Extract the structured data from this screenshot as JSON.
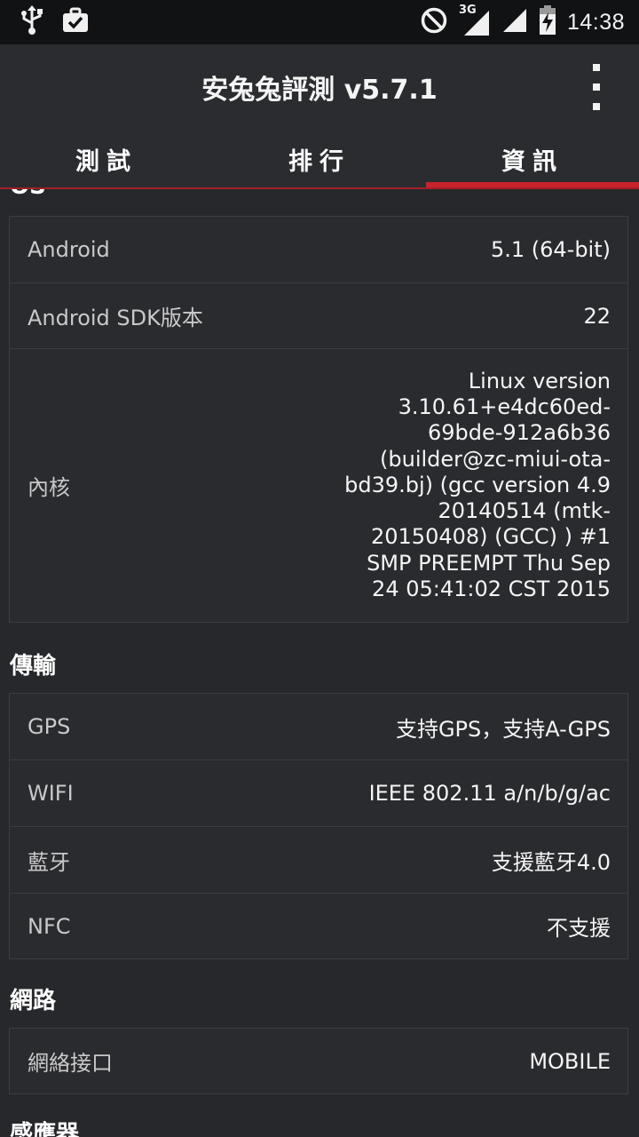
{
  "status_bar": {
    "time": "14:38",
    "network_type": "3G",
    "icons": [
      "usb-icon",
      "briefcase-check-icon",
      "do-not-disturb-icon",
      "signal-3g-icon",
      "signal-icon",
      "battery-charging-icon"
    ]
  },
  "app_bar": {
    "title": "安兔兔評測 v5.7.1"
  },
  "tabs": [
    {
      "label": "測試",
      "active": false
    },
    {
      "label": "排行",
      "active": false
    },
    {
      "label": "資訊",
      "active": true
    }
  ],
  "sections": {
    "os": {
      "title": "OS",
      "rows": [
        {
          "label": "Android",
          "value": "5.1 (64-bit)"
        },
        {
          "label": "Android SDK版本",
          "value": "22"
        },
        {
          "label": "內核",
          "value": "Linux version 3.10.61+e4dc60ed-69bde-912a6b36 (builder@zc-miui-ota-bd39.bj) (gcc version 4.9 20140514 (mtk-20150408) (GCC) ) #1 SMP PREEMPT Thu Sep 24 05:41:02 CST 2015"
        }
      ]
    },
    "transmission": {
      "title": "傳輸",
      "rows": [
        {
          "label": "GPS",
          "value": "支持GPS，支持A-GPS"
        },
        {
          "label": "WIFI",
          "value": "IEEE 802.11 a/n/b/g/ac"
        },
        {
          "label": "藍牙",
          "value": "支援藍牙4.0"
        },
        {
          "label": "NFC",
          "value": "不支援"
        }
      ]
    },
    "network": {
      "title": "網路",
      "rows": [
        {
          "label": "網絡接口",
          "value": "MOBILE"
        }
      ]
    },
    "sensors": {
      "title": "感應器"
    }
  },
  "colors": {
    "accent": "#c8232c",
    "background": "#27282c",
    "status_bar": "#111214",
    "app_bar": "#2b2c30"
  }
}
